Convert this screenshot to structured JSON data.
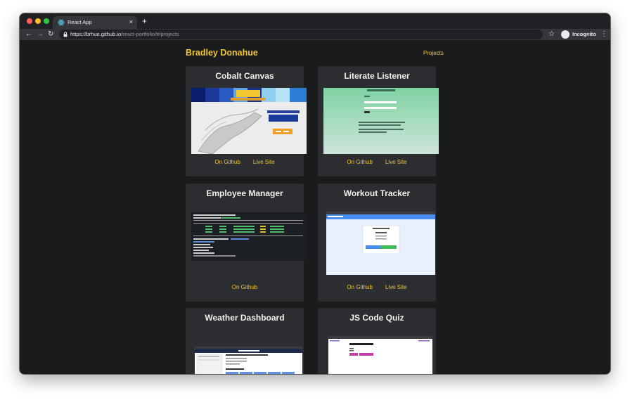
{
  "browser": {
    "tab_title": "React App",
    "tab_close": "×",
    "new_tab": "+",
    "url_host": "https://brhue.github.io",
    "url_path": "/react-portfolio/#/projects",
    "incognito_label": "Incognito",
    "icons": {
      "back": "back-arrow-icon",
      "forward": "forward-arrow-icon",
      "reload": "reload-icon",
      "lock": "lock-icon",
      "star": "star-icon",
      "menu": "kebab-menu-icon"
    }
  },
  "site": {
    "brand": "Bradley Donahue",
    "nav_link": "Projects",
    "accent": "#f2c62e"
  },
  "projects": [
    {
      "title": "Cobalt Canvas",
      "github": "On Github",
      "live": "Live Site"
    },
    {
      "title": "Literate Listener",
      "github": "On Github",
      "live": "Live Site"
    },
    {
      "title": "Employee Manager",
      "github": "On Github"
    },
    {
      "title": "Workout Tracker",
      "github": "On Github",
      "live": "Live Site"
    },
    {
      "title": "Weather Dashboard"
    },
    {
      "title": "JS Code Quiz"
    }
  ]
}
